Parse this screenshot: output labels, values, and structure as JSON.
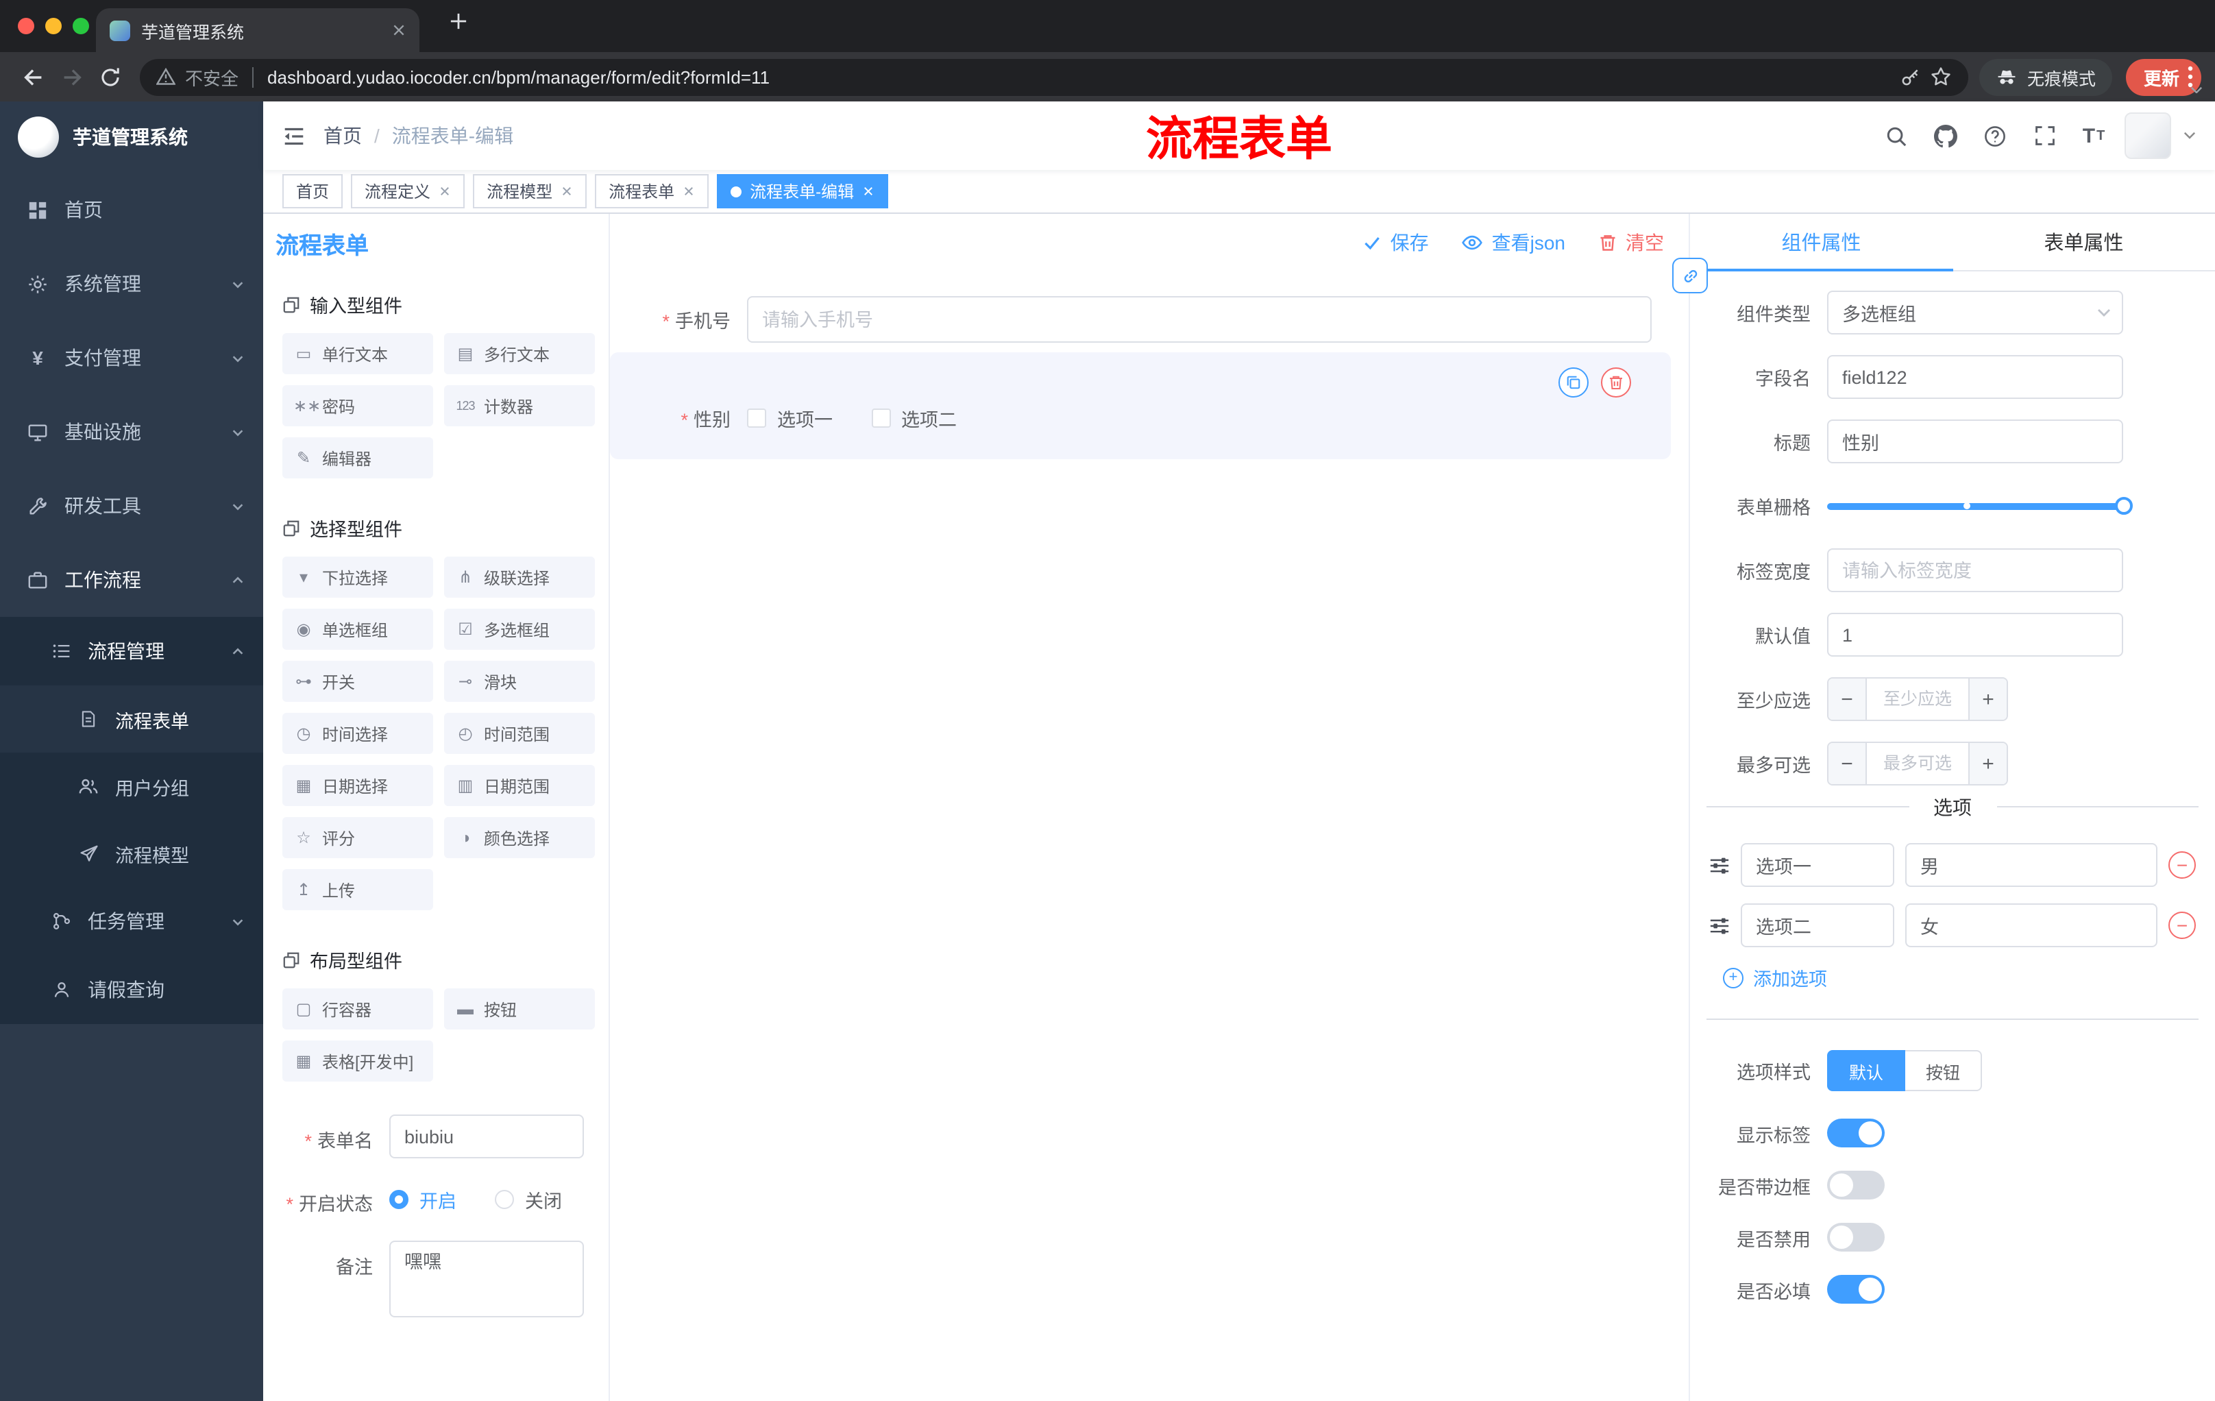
{
  "annotation": {
    "text": "流程表单"
  },
  "browser": {
    "tab_title": "芋道管理系统",
    "security_label": "不安全",
    "url": "dashboard.yudao.iocoder.cn/bpm/manager/form/edit?formId=11",
    "incognito_label": "无痕模式",
    "update_label": "更新"
  },
  "sidebar": {
    "logo_title": "芋道管理系统",
    "menu": [
      {
        "label": "首页"
      },
      {
        "label": "系统管理"
      },
      {
        "label": "支付管理"
      },
      {
        "label": "基础设施"
      },
      {
        "label": "研发工具"
      },
      {
        "label": "工作流程"
      }
    ],
    "submenu": [
      {
        "label": "流程管理"
      },
      {
        "label": "流程表单"
      },
      {
        "label": "用户分组"
      },
      {
        "label": "流程模型"
      },
      {
        "label": "任务管理"
      },
      {
        "label": "请假查询"
      }
    ]
  },
  "header": {
    "breadcrumb_home": "首页",
    "breadcrumb_current": "流程表单-编辑"
  },
  "tags": [
    {
      "label": "首页"
    },
    {
      "label": "流程定义"
    },
    {
      "label": "流程模型"
    },
    {
      "label": "流程表单"
    },
    {
      "label": "流程表单-编辑"
    }
  ],
  "designer": {
    "title": "流程表单",
    "actions": {
      "save": "保存",
      "view_json": "查看json",
      "clear": "清空"
    },
    "palette": {
      "sections": [
        {
          "title": "输入型组件",
          "items": [
            "单行文本",
            "多行文本",
            "密码",
            "计数器",
            "编辑器"
          ]
        },
        {
          "title": "选择型组件",
          "items": [
            "下拉选择",
            "级联选择",
            "单选框组",
            "多选框组",
            "开关",
            "滑块",
            "时间选择",
            "时间范围",
            "日期选择",
            "日期范围",
            "评分",
            "颜色选择",
            "上传"
          ]
        },
        {
          "title": "布局型组件",
          "items": [
            "行容器",
            "按钮",
            "表格[开发中]"
          ]
        }
      ]
    },
    "config": {
      "form_name_label": "表单名",
      "form_name_value": "biubiu",
      "status_label": "开启状态",
      "status_on": "开启",
      "status_off": "关闭",
      "remark_label": "备注",
      "remark_value": "嘿嘿"
    },
    "canvas": {
      "phone_label": "手机号",
      "phone_placeholder": "请输入手机号",
      "gender_label": "性别",
      "gender_option1": "选项一",
      "gender_option2": "选项二"
    }
  },
  "properties": {
    "tab_component": "组件属性",
    "tab_form": "表单属性",
    "component_type_label": "组件类型",
    "component_type_value": "多选框组",
    "field_name_label": "字段名",
    "field_name_value": "field122",
    "title_label": "标题",
    "title_value": "性别",
    "grid_label": "表单栅格",
    "label_width_label": "标签宽度",
    "label_width_placeholder": "请输入标签宽度",
    "default_label": "默认值",
    "default_value": "1",
    "min_label": "至少应选",
    "min_placeholder": "至少应选",
    "max_label": "最多可选",
    "max_placeholder": "最多可选",
    "options_divider": "选项",
    "options": [
      {
        "name": "选项一",
        "value": "男"
      },
      {
        "name": "选项二",
        "value": "女"
      }
    ],
    "add_option": "添加选项",
    "style_label": "选项样式",
    "style_default": "默认",
    "style_button": "按钮",
    "show_label": "显示标签",
    "border_label": "是否带边框",
    "disabled_label": "是否禁用",
    "required_label": "是否必填"
  },
  "colors": {
    "primary": "#409eff",
    "danger": "#f56c6c",
    "annotation": "#fe0000",
    "sidebar_bg": "#2d3a4b",
    "submenu_bg": "#1f2d3d",
    "tag_active_bg": "#409eff"
  }
}
